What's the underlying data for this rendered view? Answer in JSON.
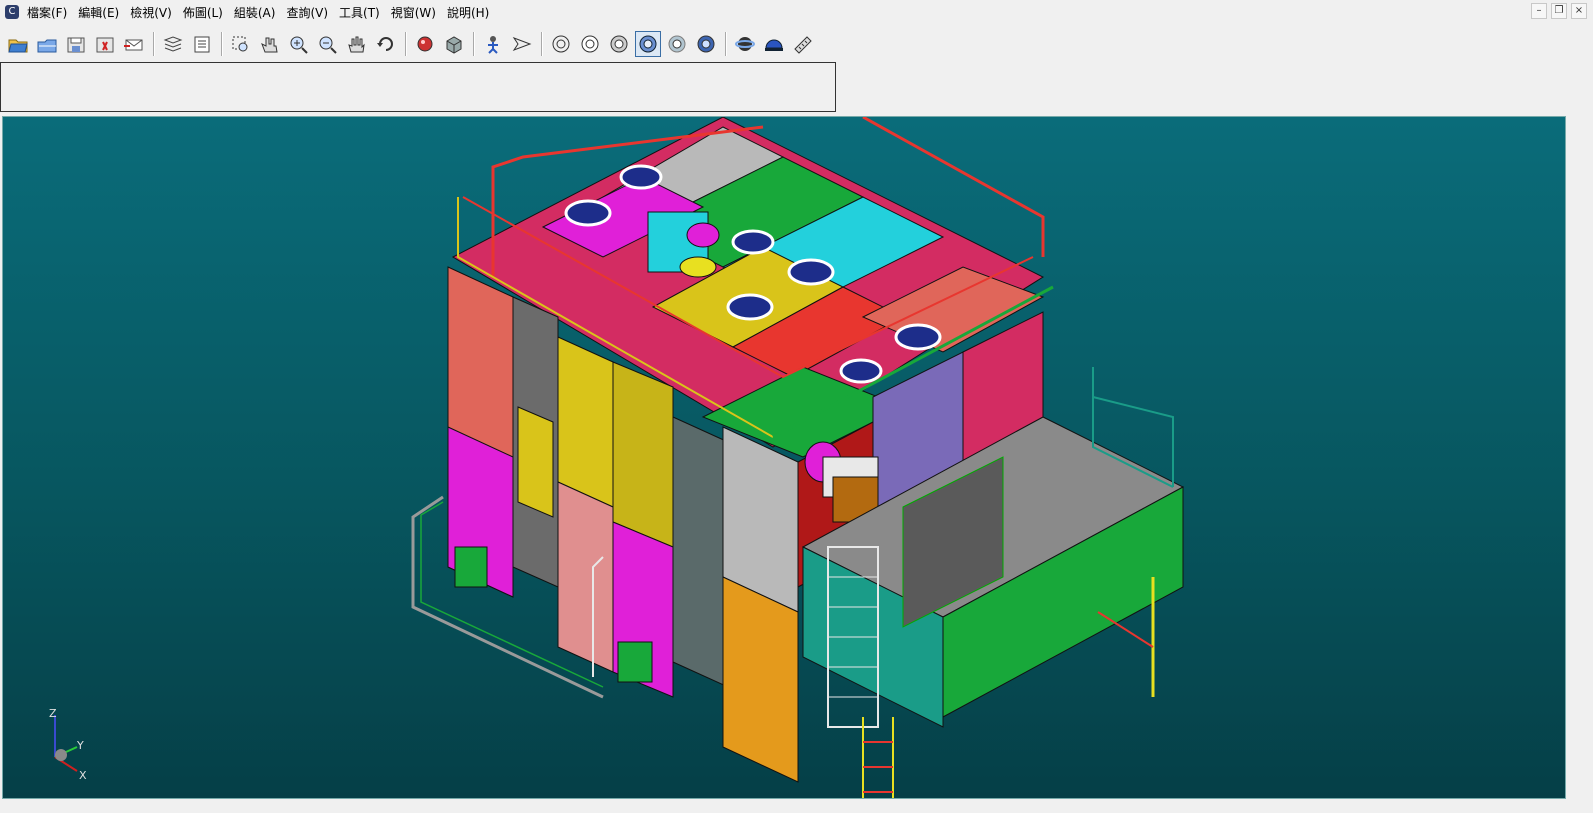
{
  "app_icon": "cad-app-icon",
  "menu": [
    {
      "label": "檔案(F)"
    },
    {
      "label": "編輯(E)"
    },
    {
      "label": "檢視(V)"
    },
    {
      "label": "佈圖(L)"
    },
    {
      "label": "組裝(A)"
    },
    {
      "label": "查詢(V)"
    },
    {
      "label": "工具(T)"
    },
    {
      "label": "視窗(W)"
    },
    {
      "label": "說明(H)"
    }
  ],
  "window_controls": {
    "minimize": "–",
    "restore": "❐",
    "close": "×"
  },
  "toolbar_icons": [
    "open-file-icon",
    "open-folder-icon",
    "save-icon",
    "save-as-icon",
    "send-mail-icon",
    "layers-icon",
    "properties-icon",
    "zoom-window-icon",
    "zoom-hand-icon",
    "zoom-in-icon",
    "zoom-out-icon",
    "pan-hand-icon",
    "rotate-icon",
    "render-icon",
    "box-view-icon",
    "figure-icon",
    "fly-through-icon",
    "wireframe-icon",
    "hidden-line-icon",
    "shaded-icon",
    "shaded-edges-icon",
    "transparent-icon",
    "realistic-icon",
    "orbit-icon",
    "helmet-icon",
    "measure-icon"
  ],
  "active_tool": "shaded-edges-icon",
  "viewport": {
    "background_top": "#0a6c7a",
    "background_bottom": "#053f47"
  },
  "axis_triad": {
    "z": "Z",
    "y": "Y",
    "x": "X"
  },
  "colors": {
    "red": "#e8362f",
    "salmon": "#e0665a",
    "magenta": "#e020d8",
    "yellow": "#d9c41a",
    "orange": "#e49a1c",
    "gray": "#b9b9b9",
    "green": "#18a83a",
    "cyan": "#23d0dc",
    "teal": "#1a9c88",
    "purple": "#7a6ab8",
    "darkred": "#b01818"
  }
}
